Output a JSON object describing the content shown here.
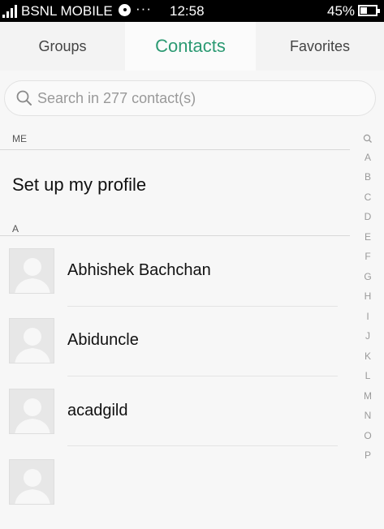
{
  "status_bar": {
    "carrier": "BSNL MOBILE",
    "more": "···",
    "time": "12:58",
    "battery_percent": "45%",
    "battery_level": 0.45,
    "icons": [
      "signal-icon",
      "notification-dot-icon",
      "battery-icon"
    ]
  },
  "tabs": [
    {
      "label": "Groups",
      "active": false
    },
    {
      "label": "Contacts",
      "active": true
    },
    {
      "label": "Favorites",
      "active": false
    }
  ],
  "colors": {
    "accent": "#2c9a73",
    "background": "#f7f7f7"
  },
  "search": {
    "placeholder": "Search in 277 contact(s)",
    "icon": "search-icon"
  },
  "me_section": {
    "header": "ME",
    "profile_label": "Set up my profile"
  },
  "contact_sections": [
    {
      "header": "A",
      "contacts": [
        {
          "name": "Abhishek Bachchan"
        },
        {
          "name": "Abiduncle"
        },
        {
          "name": "acadgild"
        },
        {
          "name": ""
        }
      ]
    }
  ],
  "index_letters": [
    "A",
    "B",
    "C",
    "D",
    "E",
    "F",
    "G",
    "H",
    "I",
    "J",
    "K",
    "L",
    "M",
    "N",
    "O",
    "P"
  ],
  "index_search_icon": "search-icon"
}
